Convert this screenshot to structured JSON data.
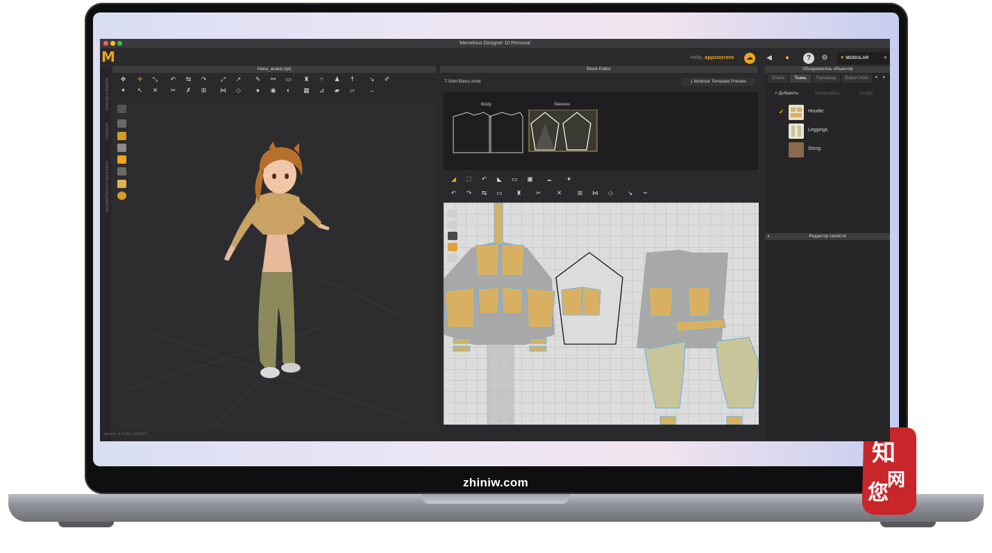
{
  "app": {
    "window_title": "Marvelous Designer 10 Personal",
    "hello_label": "Hello,",
    "username": "appstorrent",
    "mode_button": "MODULAR",
    "status_text": "Version: 6.0.355 (105317)"
  },
  "viewport": {
    "tab_title": "Hana_avatar.zprj",
    "side_labels": [
      "AVATAR PREVIEW",
      "HISTORY",
      "MODULAR CONFIGURATOR"
    ]
  },
  "block_editor": {
    "panel_title": "Block Editor",
    "file_name": "T-Shirt.Basic.zmdr",
    "presets_button": "Modular Template Presets",
    "blocks": [
      {
        "label": "Body"
      },
      {
        "label": "Sleeves"
      }
    ]
  },
  "object_browser": {
    "panel_title": "Обозреватель объектов",
    "tabs": [
      "Scene",
      "Ткань",
      "Пуговица",
      "Button Hole"
    ],
    "active_tab": "Ткань",
    "actions": [
      "Добавить",
      "Копировать",
      "Assign"
    ],
    "fabrics": [
      {
        "name": "Hoodie",
        "color": "#d4a95a",
        "checked": true
      },
      {
        "name": "Leggings",
        "color": "#c9c59a",
        "checked": false
      },
      {
        "name": "String",
        "color": "#8b6a4c",
        "checked": false
      }
    ]
  },
  "property_editor": {
    "panel_title": "Редактор свойств"
  },
  "laptop": {
    "chin_label": "zhiniw.com"
  },
  "colors": {
    "accent": "#f0a41a",
    "fabric_yellow": "#d9b062",
    "pattern_bg": "#dcdcdc"
  },
  "icons": {
    "logo": "marvelous-logo-icon",
    "cloud": "cloud-icon",
    "sound": "speaker-icon",
    "user": "user-icon",
    "help": "help-icon",
    "settings": "settings-icon",
    "modular": "modular-shirt-icon"
  }
}
